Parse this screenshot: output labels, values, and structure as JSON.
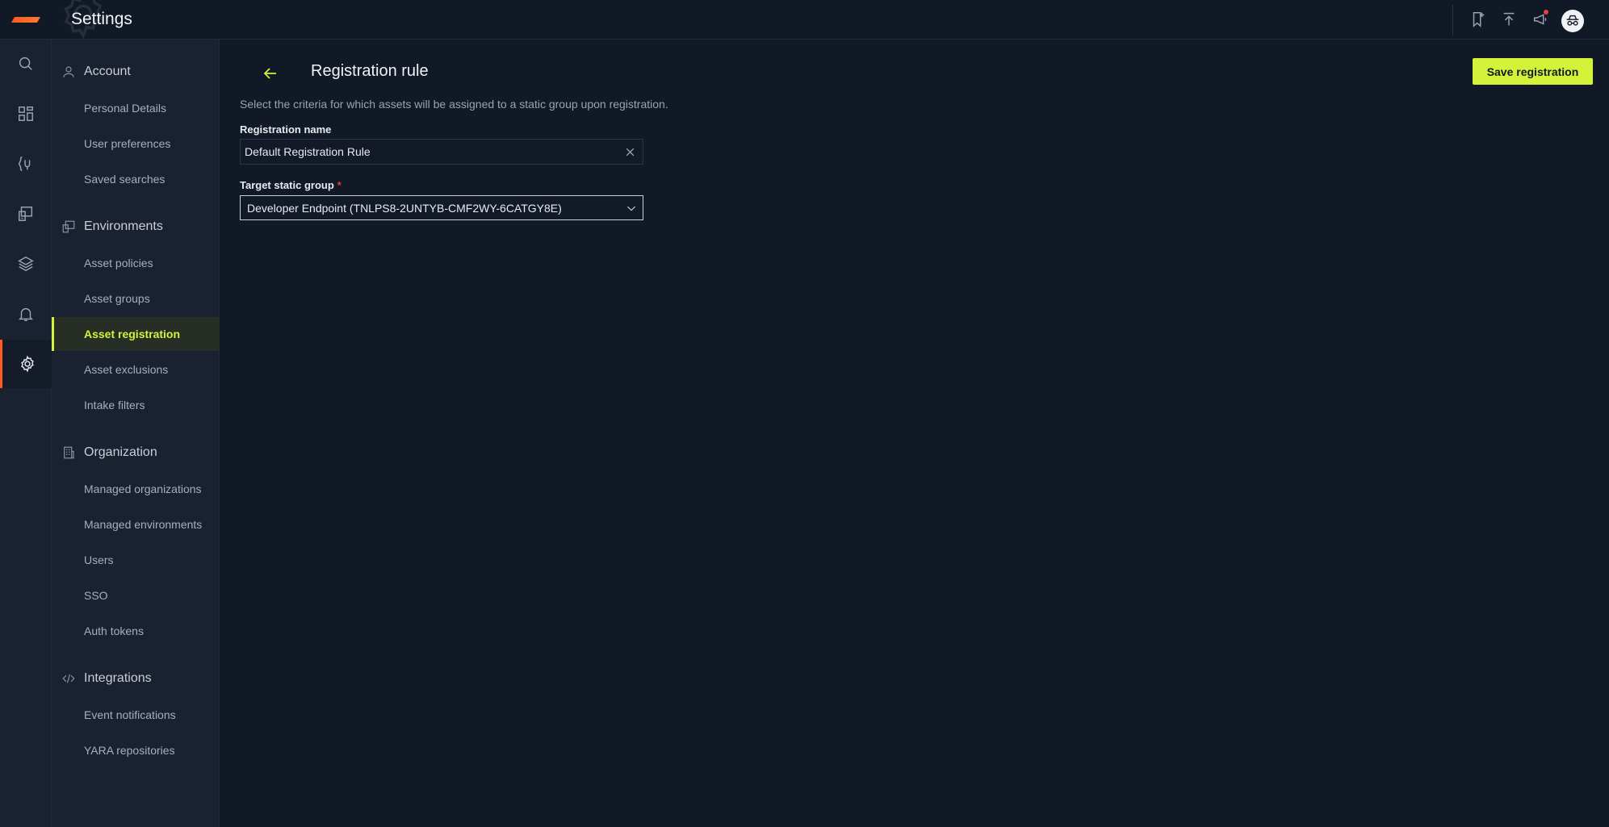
{
  "app": {
    "title": "Settings"
  },
  "sidebar": {
    "sections": [
      {
        "label": "Account",
        "icon": "user-icon",
        "items": [
          {
            "label": "Personal Details"
          },
          {
            "label": "User preferences"
          },
          {
            "label": "Saved searches"
          }
        ]
      },
      {
        "label": "Environments",
        "icon": "environments-icon",
        "items": [
          {
            "label": "Asset policies"
          },
          {
            "label": "Asset groups"
          },
          {
            "label": "Asset registration",
            "active": true
          },
          {
            "label": "Asset exclusions"
          },
          {
            "label": "Intake filters"
          }
        ]
      },
      {
        "label": "Organization",
        "icon": "building-icon",
        "items": [
          {
            "label": "Managed organizations"
          },
          {
            "label": "Managed environments"
          },
          {
            "label": "Users"
          },
          {
            "label": "SSO"
          },
          {
            "label": "Auth tokens"
          }
        ]
      },
      {
        "label": "Integrations",
        "icon": "code-icon",
        "items": [
          {
            "label": "Event notifications"
          },
          {
            "label": "YARA repositories"
          }
        ]
      }
    ]
  },
  "main": {
    "title": "Registration rule",
    "save_label": "Save registration",
    "description": "Select the criteria for which assets will be assigned to a static group upon registration.",
    "registration_name": {
      "label": "Registration name",
      "value": "Default Registration Rule"
    },
    "target_group": {
      "label": "Target static group",
      "required_mark": "*",
      "value": "Developer Endpoint (TNLPS8-2UNTYB-CMF2WY-6CATGY8E)"
    }
  },
  "colors": {
    "accent": "#d4f23a",
    "brand": "#ff5a1f",
    "background": "#111826",
    "sidebar": "#1a2130",
    "notification_dot": "#e53e3e"
  }
}
